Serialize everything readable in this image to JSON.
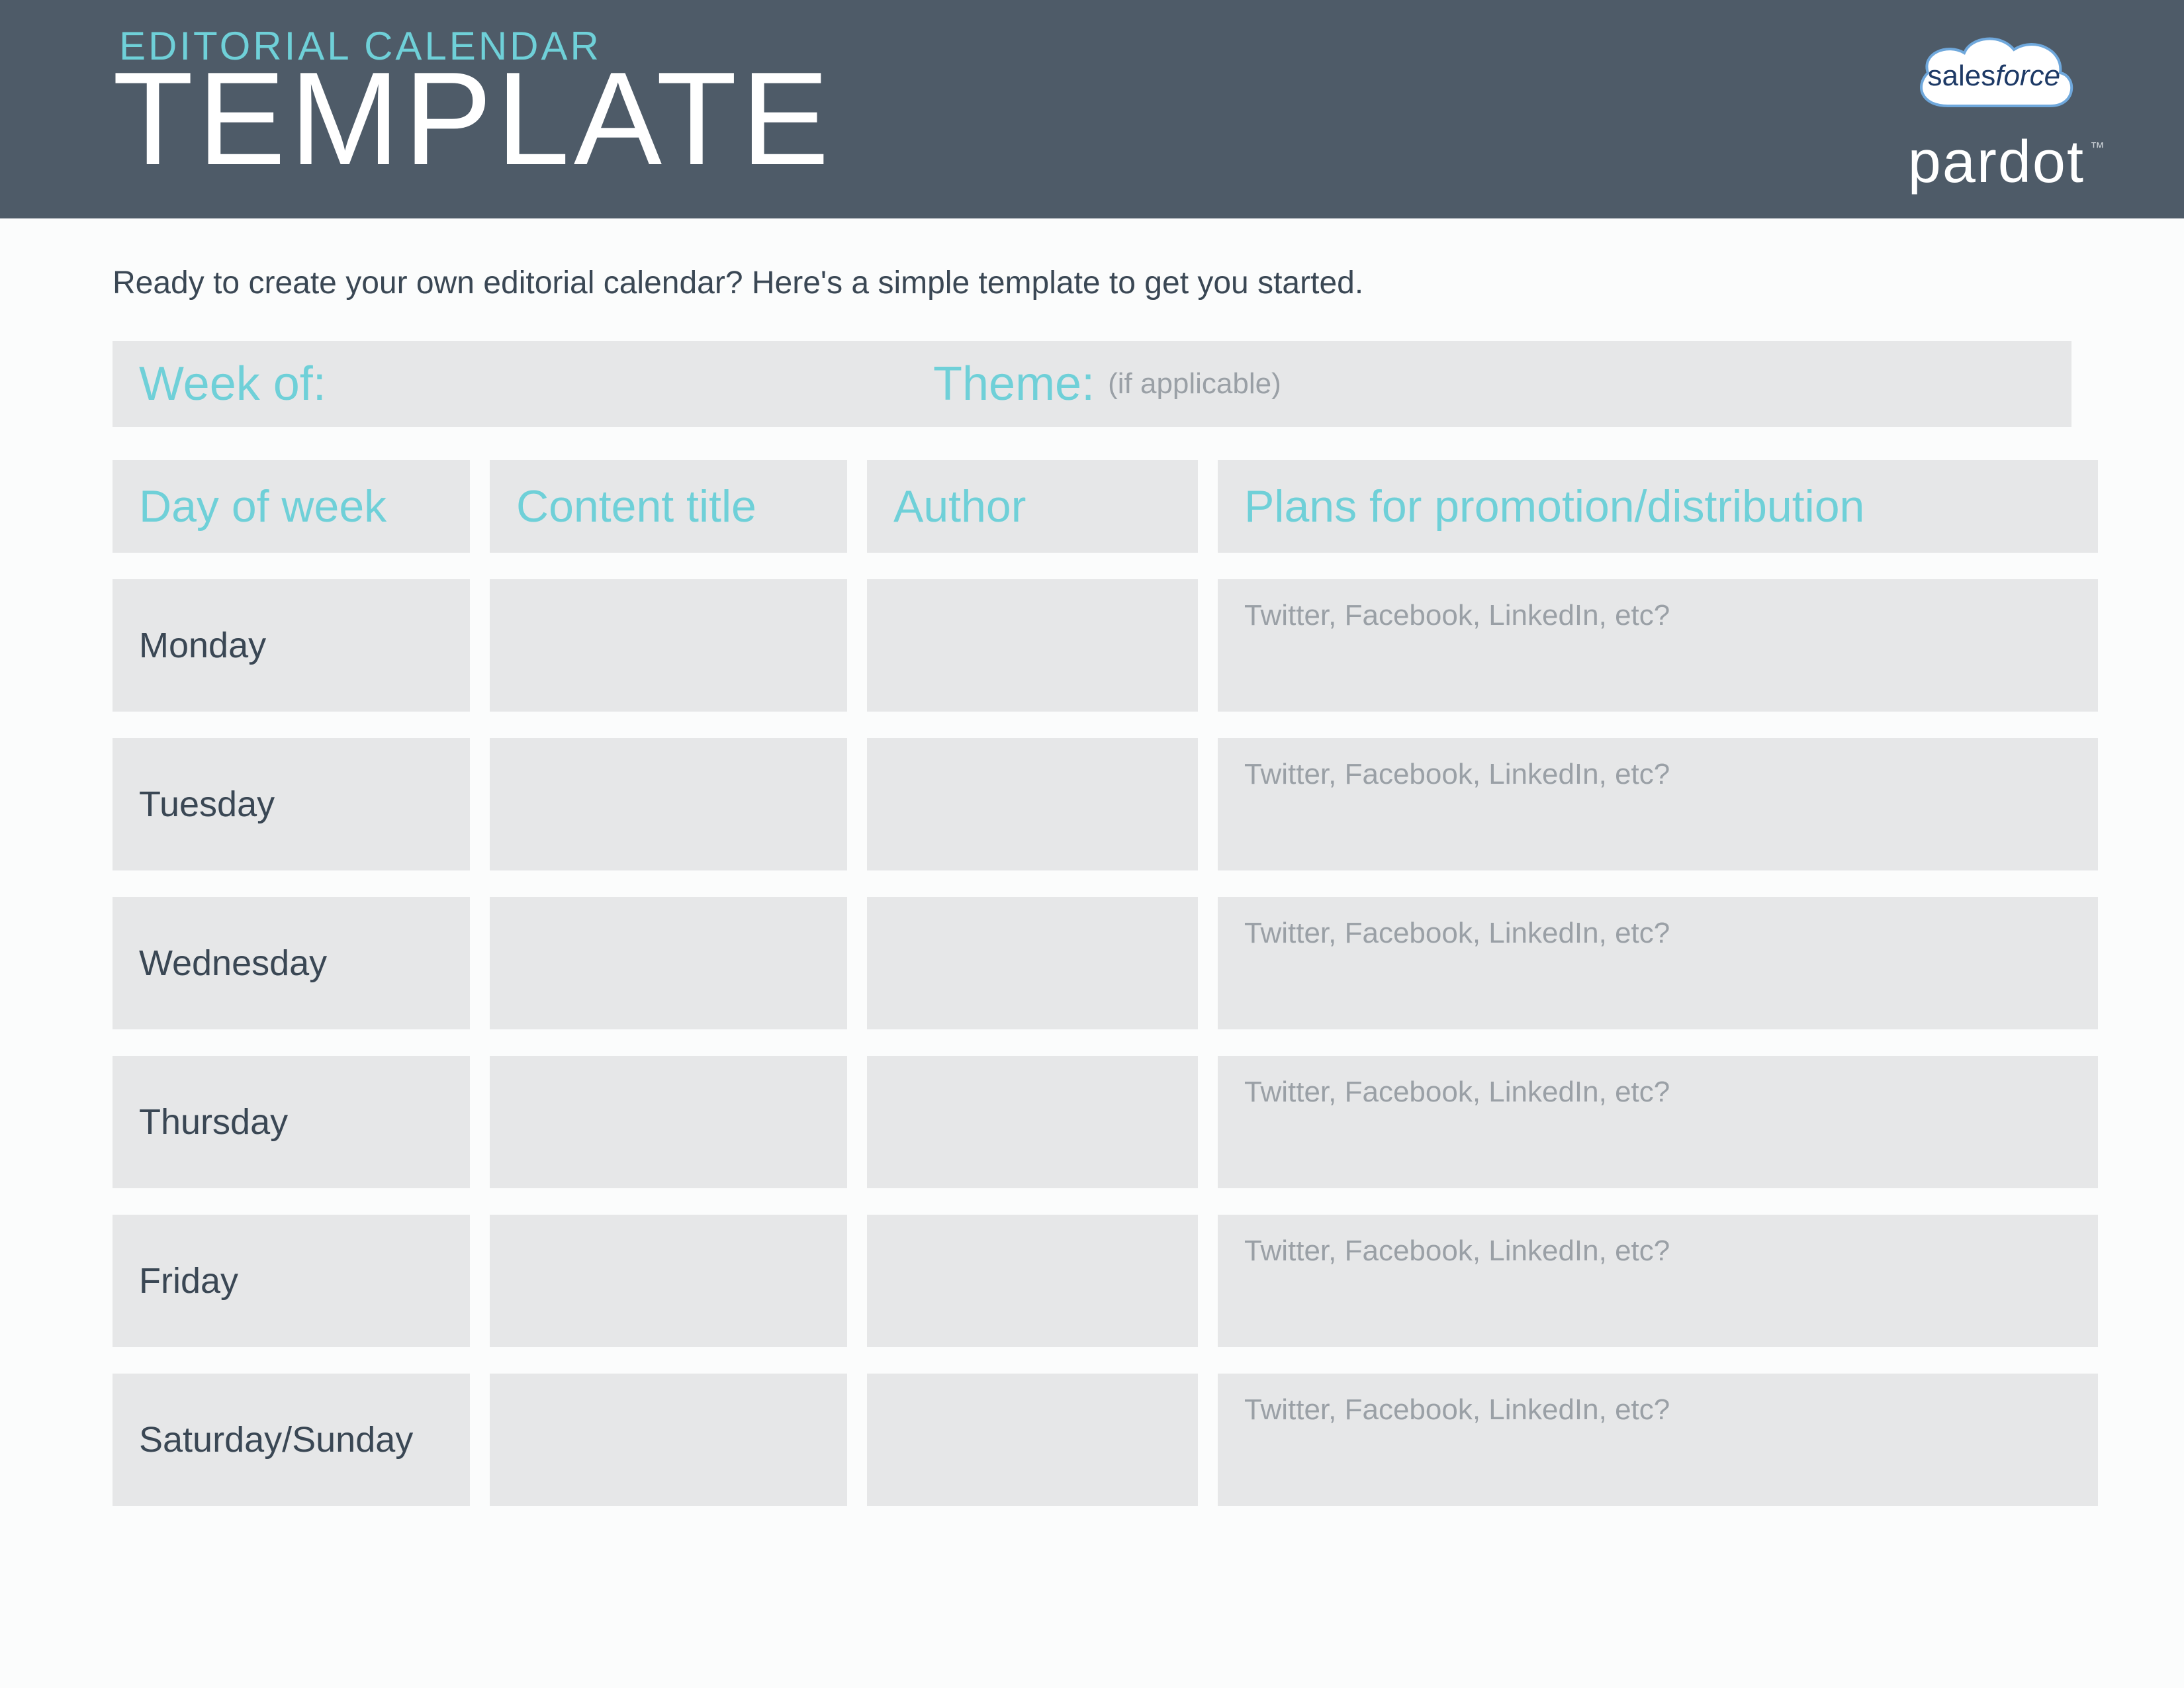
{
  "header": {
    "kicker": "EDITORIAL CALENDAR",
    "title": "TEMPLATE"
  },
  "logo": {
    "cloud_text_a": "sales",
    "cloud_text_b": "force",
    "brand": "pardot",
    "tm": "™"
  },
  "intro": "Ready to create your own editorial calendar? Here's a simple template to get you started.",
  "meta": {
    "week_label": "Week of:",
    "theme_label": "Theme:",
    "theme_note": "(if applicable)"
  },
  "columns": {
    "day": "Day of week",
    "title": "Content title",
    "author": "Author",
    "plans": "Plans for promotion/distribution"
  },
  "rows": [
    {
      "day": "Monday",
      "plans_hint": "Twitter, Facebook, LinkedIn, etc?"
    },
    {
      "day": "Tuesday",
      "plans_hint": "Twitter, Facebook, LinkedIn, etc?"
    },
    {
      "day": "Wednesday",
      "plans_hint": "Twitter, Facebook, LinkedIn, etc?"
    },
    {
      "day": "Thursday",
      "plans_hint": "Twitter, Facebook, LinkedIn, etc?"
    },
    {
      "day": "Friday",
      "plans_hint": "Twitter, Facebook, LinkedIn, etc?"
    },
    {
      "day": "Saturday/Sunday",
      "plans_hint": "Twitter, Facebook, LinkedIn, etc?"
    }
  ]
}
